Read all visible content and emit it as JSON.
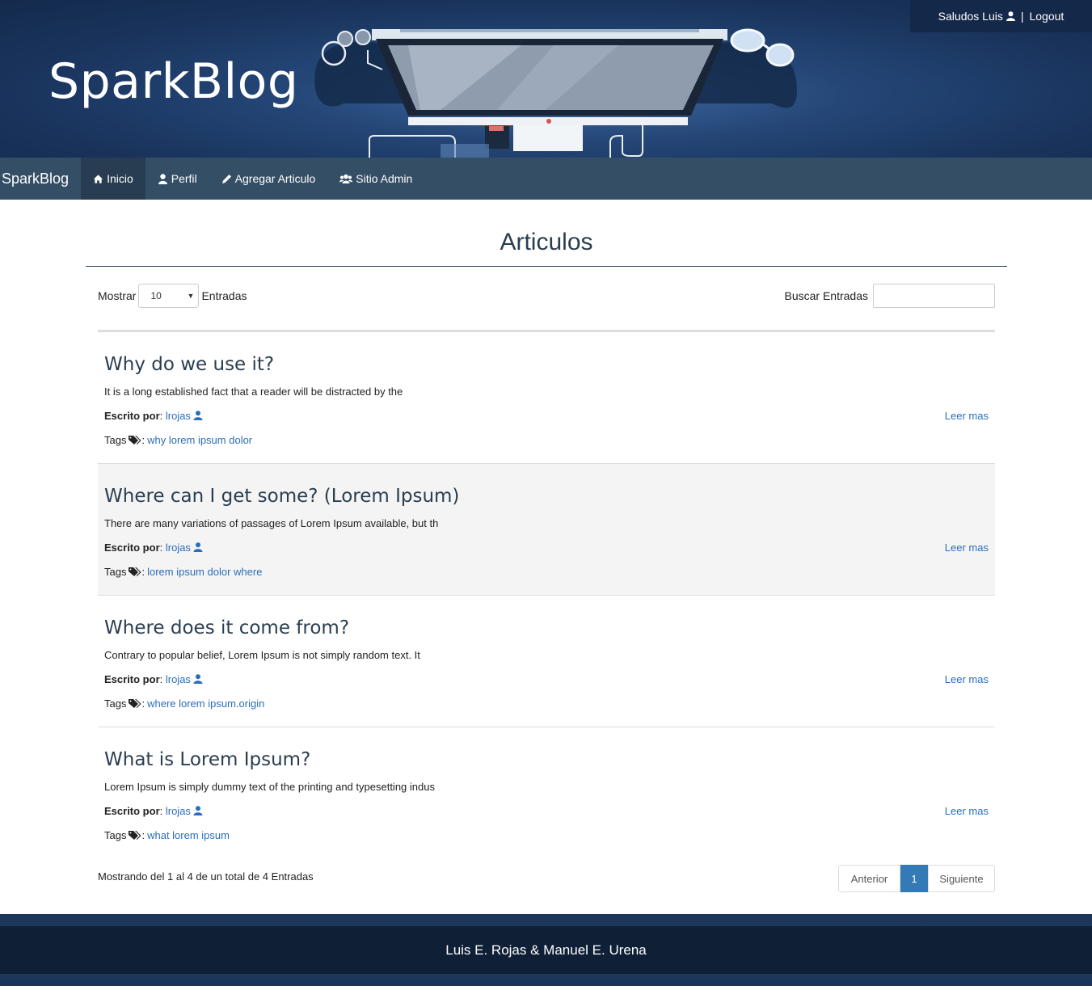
{
  "header": {
    "site_title": "SparkBlog",
    "greeting": "Saludos Luis",
    "logout_label": "Logout",
    "separator": "|"
  },
  "navbar": {
    "brand": "SparkBlog",
    "items": [
      {
        "label": "Inicio",
        "icon": "home-icon",
        "active": true
      },
      {
        "label": "Perfil",
        "icon": "user-icon",
        "active": false
      },
      {
        "label": "Agregar Articulo",
        "icon": "pencil-icon",
        "active": false
      },
      {
        "label": "Sitio Admin",
        "icon": "users-icon",
        "active": false
      }
    ]
  },
  "main": {
    "heading": "Articulos",
    "show_label": "Mostrar",
    "show_value": "10",
    "entries_label": "Entradas",
    "search_label": "Buscar Entradas",
    "search_value": ""
  },
  "articles": [
    {
      "title": "Why do we use it?",
      "excerpt": "It is a long established fact that a reader will be distracted by the",
      "author_label": "Escrito por",
      "author": "lrojas",
      "tags_label": "Tags",
      "tags": "why lorem ipsum dolor",
      "read_more": "Leer mas"
    },
    {
      "title": "Where can I get some? (Lorem Ipsum)",
      "excerpt": "There are many variations of passages of Lorem Ipsum available, but th",
      "author_label": "Escrito por",
      "author": "lrojas",
      "tags_label": "Tags",
      "tags": "lorem ipsum dolor where",
      "read_more": "Leer mas"
    },
    {
      "title": "Where does it come from?",
      "excerpt": "Contrary to popular belief, Lorem Ipsum is not simply random text. It",
      "author_label": "Escrito por",
      "author": "lrojas",
      "tags_label": "Tags",
      "tags": "where lorem ipsum.origin",
      "read_more": "Leer mas"
    },
    {
      "title": "What is Lorem Ipsum?",
      "excerpt": "Lorem Ipsum is simply dummy text of the printing and typesetting indus",
      "author_label": "Escrito por",
      "author": "lrojas",
      "tags_label": "Tags",
      "tags": "what lorem ipsum",
      "read_more": "Leer mas"
    }
  ],
  "pagination": {
    "info": "Mostrando del 1 al 4 de un total de 4 Entradas",
    "prev": "Anterior",
    "current": "1",
    "next": "Siguiente"
  },
  "footer": {
    "credits": "Luis E. Rojas & Manuel E. Urena"
  },
  "colors": {
    "accent": "#337ab7",
    "link": "#2a6ebb",
    "navbar": "#344e66",
    "heading": "#2b3e50"
  }
}
